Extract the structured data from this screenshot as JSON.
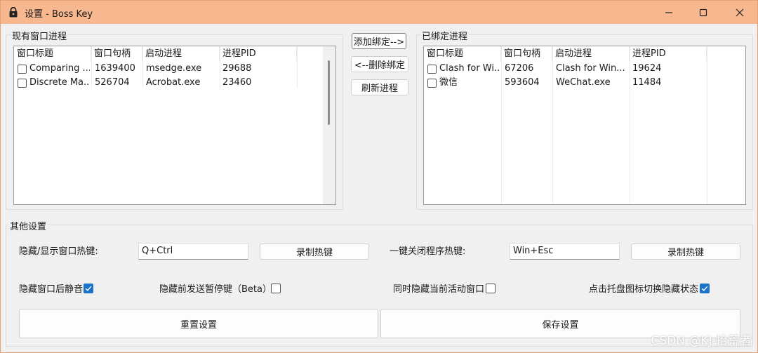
{
  "window": {
    "title": "设置 - Boss Key"
  },
  "existing": {
    "group_label": "现有窗口进程",
    "columns": [
      "窗口标题",
      "窗口句柄",
      "启动进程",
      "进程PID"
    ],
    "rows": [
      {
        "title": "Comparing ...",
        "handle": "1639400",
        "process": "msedge.exe",
        "pid": "29688"
      },
      {
        "title": "Discrete Ma...",
        "handle": "526704",
        "process": "Acrobat.exe",
        "pid": "23460"
      }
    ]
  },
  "bound": {
    "group_label": "已绑定进程",
    "columns": [
      "窗口标题",
      "窗口句柄",
      "启动进程",
      "进程PID"
    ],
    "rows": [
      {
        "title": "Clash for Wi...",
        "handle": "67206",
        "process": "Clash for Win...",
        "pid": "19624"
      },
      {
        "title": "微信",
        "handle": "593604",
        "process": "WeChat.exe",
        "pid": "11484"
      }
    ]
  },
  "middle_buttons": {
    "add": "添加绑定-->",
    "remove": "<--删除绑定",
    "refresh": "刷新进程"
  },
  "other": {
    "group_label": "其他设置",
    "hide_hotkey_label": "隐藏/显示窗口热键:",
    "hide_hotkey_value": "Q+Ctrl",
    "record_hotkey_1": "录制热键",
    "close_hotkey_label": "一键关闭程序热键:",
    "close_hotkey_value": "Win+Esc",
    "record_hotkey_2": "录制热键",
    "opt_mute": {
      "label": "隐藏窗口后静音",
      "checked": true
    },
    "opt_pause": {
      "label": "隐藏前发送暂停键（Beta）",
      "checked": false
    },
    "opt_active": {
      "label": "同时隐藏当前活动窗口",
      "checked": false
    },
    "opt_tray": {
      "label": "点击托盘图标切换隐藏状态",
      "checked": true
    },
    "reset": "重置设置",
    "save": "保存设置"
  },
  "watermark": "CSDN @KJ-拾荒者"
}
